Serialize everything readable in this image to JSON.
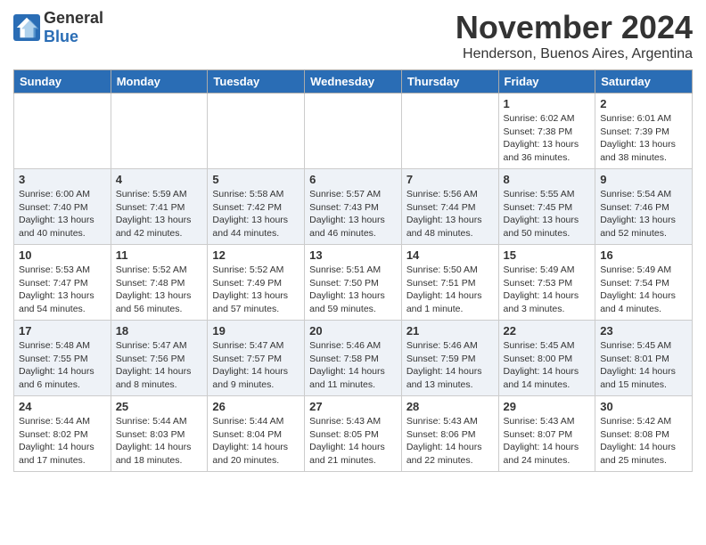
{
  "header": {
    "logo_general": "General",
    "logo_blue": "Blue",
    "month_title": "November 2024",
    "location": "Henderson, Buenos Aires, Argentina"
  },
  "days_of_week": [
    "Sunday",
    "Monday",
    "Tuesday",
    "Wednesday",
    "Thursday",
    "Friday",
    "Saturday"
  ],
  "weeks": [
    [
      {
        "day": "",
        "info": ""
      },
      {
        "day": "",
        "info": ""
      },
      {
        "day": "",
        "info": ""
      },
      {
        "day": "",
        "info": ""
      },
      {
        "day": "",
        "info": ""
      },
      {
        "day": "1",
        "info": "Sunrise: 6:02 AM\nSunset: 7:38 PM\nDaylight: 13 hours\nand 36 minutes."
      },
      {
        "day": "2",
        "info": "Sunrise: 6:01 AM\nSunset: 7:39 PM\nDaylight: 13 hours\nand 38 minutes."
      }
    ],
    [
      {
        "day": "3",
        "info": "Sunrise: 6:00 AM\nSunset: 7:40 PM\nDaylight: 13 hours\nand 40 minutes."
      },
      {
        "day": "4",
        "info": "Sunrise: 5:59 AM\nSunset: 7:41 PM\nDaylight: 13 hours\nand 42 minutes."
      },
      {
        "day": "5",
        "info": "Sunrise: 5:58 AM\nSunset: 7:42 PM\nDaylight: 13 hours\nand 44 minutes."
      },
      {
        "day": "6",
        "info": "Sunrise: 5:57 AM\nSunset: 7:43 PM\nDaylight: 13 hours\nand 46 minutes."
      },
      {
        "day": "7",
        "info": "Sunrise: 5:56 AM\nSunset: 7:44 PM\nDaylight: 13 hours\nand 48 minutes."
      },
      {
        "day": "8",
        "info": "Sunrise: 5:55 AM\nSunset: 7:45 PM\nDaylight: 13 hours\nand 50 minutes."
      },
      {
        "day": "9",
        "info": "Sunrise: 5:54 AM\nSunset: 7:46 PM\nDaylight: 13 hours\nand 52 minutes."
      }
    ],
    [
      {
        "day": "10",
        "info": "Sunrise: 5:53 AM\nSunset: 7:47 PM\nDaylight: 13 hours\nand 54 minutes."
      },
      {
        "day": "11",
        "info": "Sunrise: 5:52 AM\nSunset: 7:48 PM\nDaylight: 13 hours\nand 56 minutes."
      },
      {
        "day": "12",
        "info": "Sunrise: 5:52 AM\nSunset: 7:49 PM\nDaylight: 13 hours\nand 57 minutes."
      },
      {
        "day": "13",
        "info": "Sunrise: 5:51 AM\nSunset: 7:50 PM\nDaylight: 13 hours\nand 59 minutes."
      },
      {
        "day": "14",
        "info": "Sunrise: 5:50 AM\nSunset: 7:51 PM\nDaylight: 14 hours\nand 1 minute."
      },
      {
        "day": "15",
        "info": "Sunrise: 5:49 AM\nSunset: 7:53 PM\nDaylight: 14 hours\nand 3 minutes."
      },
      {
        "day": "16",
        "info": "Sunrise: 5:49 AM\nSunset: 7:54 PM\nDaylight: 14 hours\nand 4 minutes."
      }
    ],
    [
      {
        "day": "17",
        "info": "Sunrise: 5:48 AM\nSunset: 7:55 PM\nDaylight: 14 hours\nand 6 minutes."
      },
      {
        "day": "18",
        "info": "Sunrise: 5:47 AM\nSunset: 7:56 PM\nDaylight: 14 hours\nand 8 minutes."
      },
      {
        "day": "19",
        "info": "Sunrise: 5:47 AM\nSunset: 7:57 PM\nDaylight: 14 hours\nand 9 minutes."
      },
      {
        "day": "20",
        "info": "Sunrise: 5:46 AM\nSunset: 7:58 PM\nDaylight: 14 hours\nand 11 minutes."
      },
      {
        "day": "21",
        "info": "Sunrise: 5:46 AM\nSunset: 7:59 PM\nDaylight: 14 hours\nand 13 minutes."
      },
      {
        "day": "22",
        "info": "Sunrise: 5:45 AM\nSunset: 8:00 PM\nDaylight: 14 hours\nand 14 minutes."
      },
      {
        "day": "23",
        "info": "Sunrise: 5:45 AM\nSunset: 8:01 PM\nDaylight: 14 hours\nand 15 minutes."
      }
    ],
    [
      {
        "day": "24",
        "info": "Sunrise: 5:44 AM\nSunset: 8:02 PM\nDaylight: 14 hours\nand 17 minutes."
      },
      {
        "day": "25",
        "info": "Sunrise: 5:44 AM\nSunset: 8:03 PM\nDaylight: 14 hours\nand 18 minutes."
      },
      {
        "day": "26",
        "info": "Sunrise: 5:44 AM\nSunset: 8:04 PM\nDaylight: 14 hours\nand 20 minutes."
      },
      {
        "day": "27",
        "info": "Sunrise: 5:43 AM\nSunset: 8:05 PM\nDaylight: 14 hours\nand 21 minutes."
      },
      {
        "day": "28",
        "info": "Sunrise: 5:43 AM\nSunset: 8:06 PM\nDaylight: 14 hours\nand 22 minutes."
      },
      {
        "day": "29",
        "info": "Sunrise: 5:43 AM\nSunset: 8:07 PM\nDaylight: 14 hours\nand 24 minutes."
      },
      {
        "day": "30",
        "info": "Sunrise: 5:42 AM\nSunset: 8:08 PM\nDaylight: 14 hours\nand 25 minutes."
      }
    ]
  ]
}
